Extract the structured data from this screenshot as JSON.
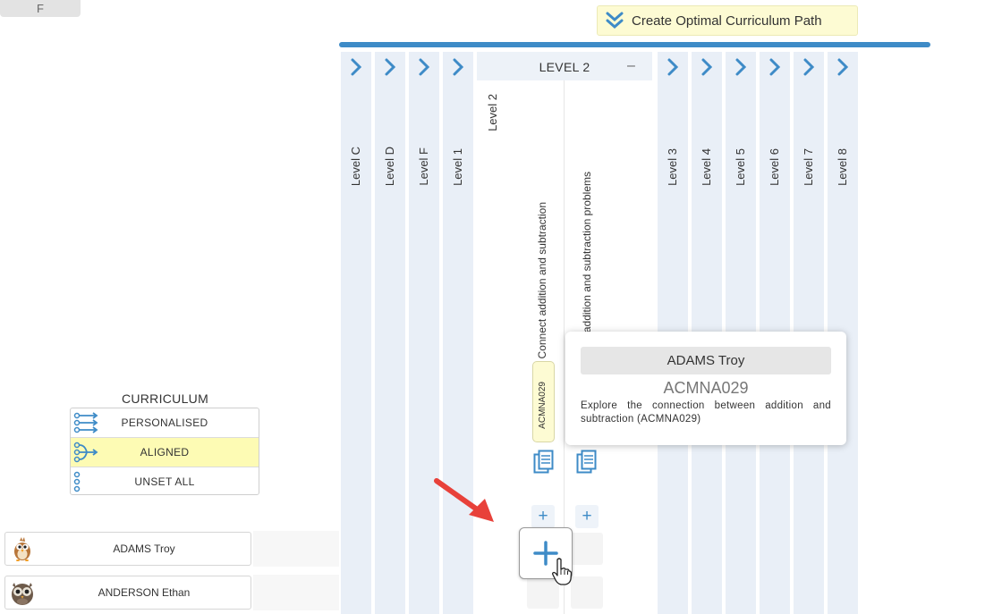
{
  "top_left_button": {
    "label": "F"
  },
  "create_path": {
    "label": "Create Optimal Curriculum Path",
    "icon": "double-chevron-down-icon"
  },
  "levels": {
    "collapsed_before": [
      "Level C",
      "Level D",
      "Level F",
      "Level 1"
    ],
    "expanded": {
      "header": "LEVEL 2",
      "collapse_symbol": "–",
      "level_label": "Level 2",
      "subtopics": [
        "Connect addition and subtraction",
        "addition and subtraction problems"
      ],
      "code_chip": "ACMNA029"
    },
    "collapsed_after": [
      "Level 3",
      "Level 4",
      "Level 5",
      "Level 6",
      "Level 7",
      "Level 8"
    ]
  },
  "tooltip": {
    "student": "ADAMS Troy",
    "code": "ACMNA029",
    "description": "Explore the connection between addition and subtraction (ACMNA029)"
  },
  "curriculum": {
    "title": "CURRICULUM",
    "options": [
      {
        "label": "PERSONALISED",
        "selected": false
      },
      {
        "label": "ALIGNED",
        "selected": true
      },
      {
        "label": "UNSET ALL",
        "selected": false
      }
    ]
  },
  "students": [
    {
      "name": "ADAMS Troy",
      "avatar": "bird-avatar"
    },
    {
      "name": "ANDERSON Ethan",
      "avatar": "owl-avatar"
    }
  ],
  "colors": {
    "accent": "#3e8bc7",
    "column_bg": "#e9eff7",
    "highlight": "#fdfbb4",
    "arrow": "#e8413a"
  }
}
